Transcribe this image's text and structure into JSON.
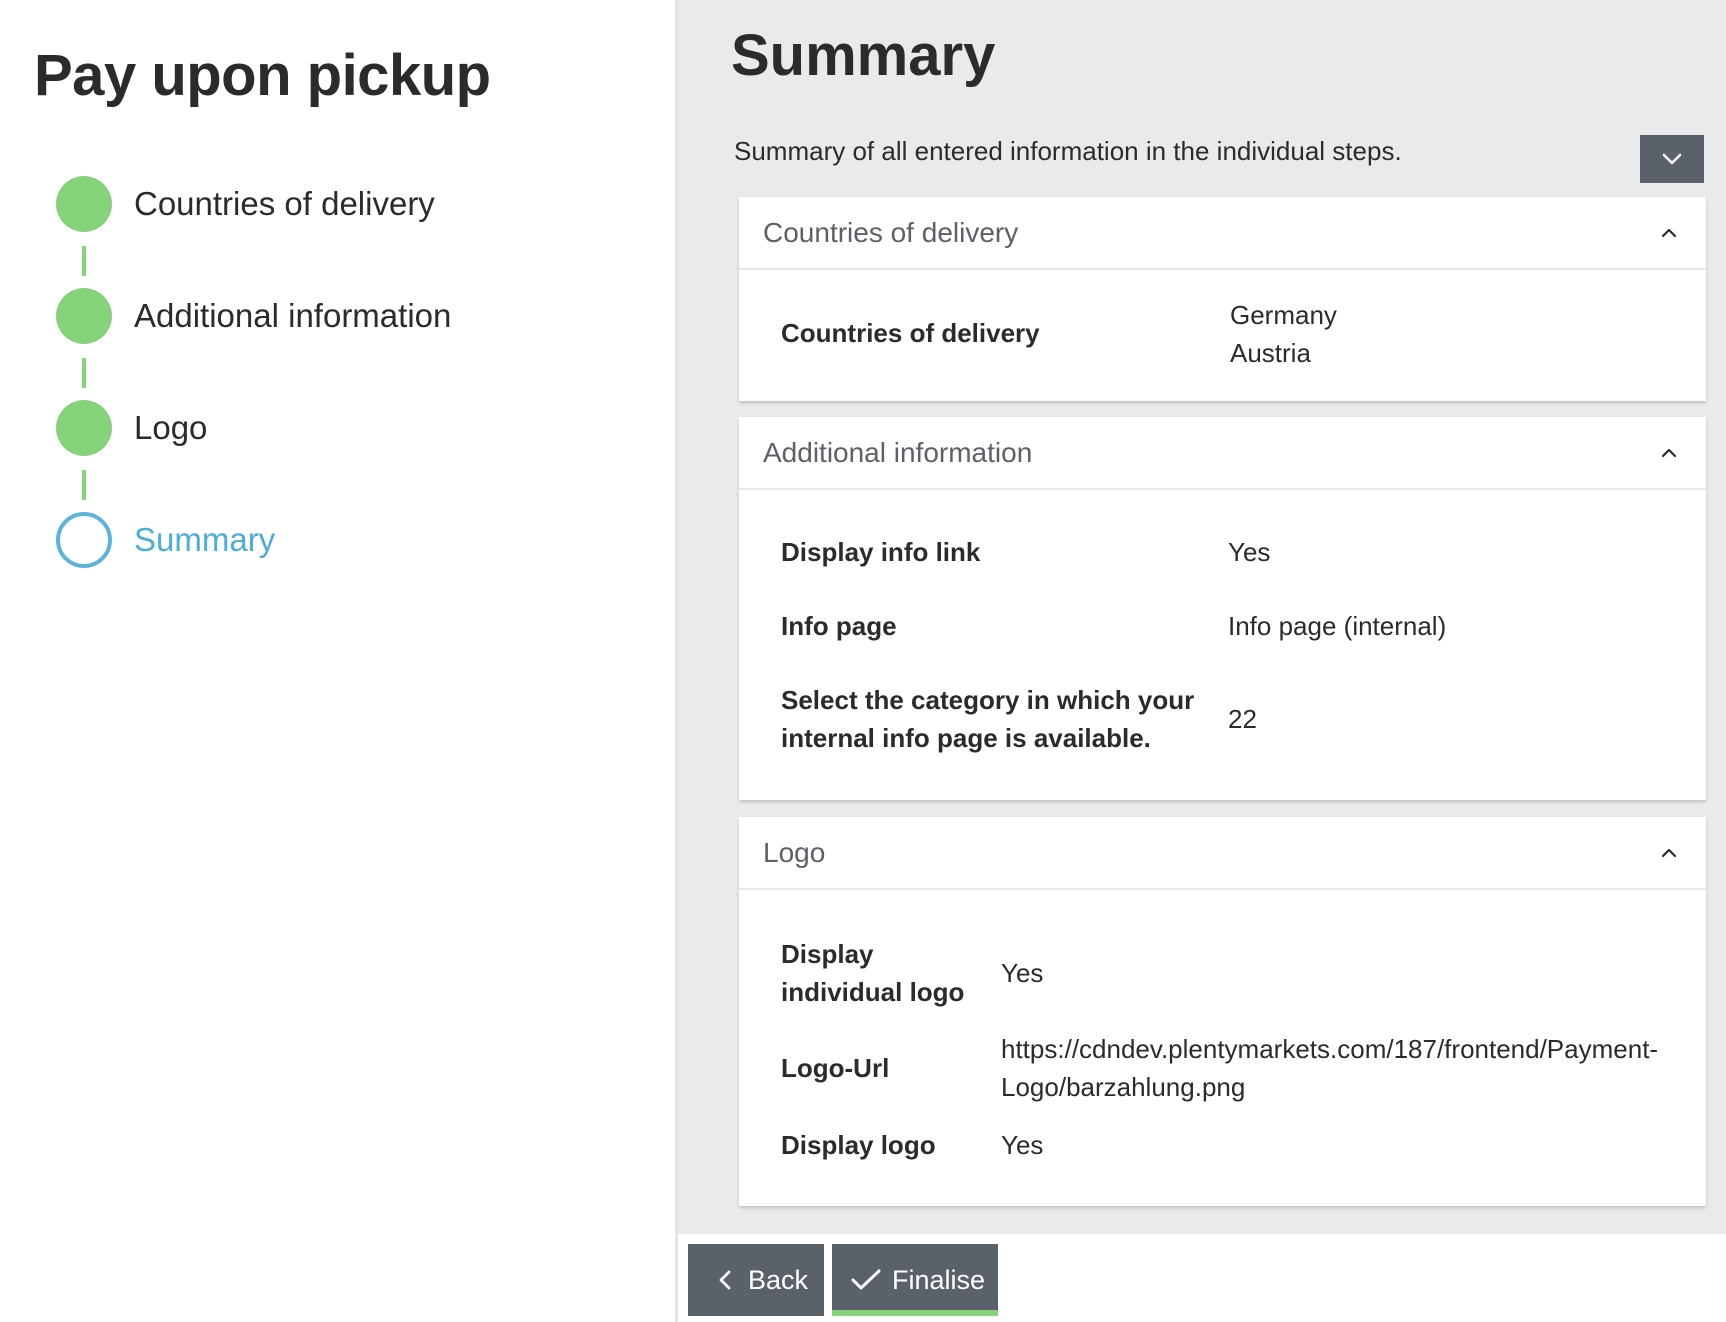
{
  "wizard": {
    "title": "Pay upon pickup",
    "steps": [
      {
        "label": "Countries of delivery",
        "state": "done"
      },
      {
        "label": "Additional information",
        "state": "done"
      },
      {
        "label": "Logo",
        "state": "done"
      },
      {
        "label": "Summary",
        "state": "current"
      }
    ]
  },
  "summary": {
    "title": "Summary",
    "description": "Summary of all entered information in the individual steps.",
    "sections": [
      {
        "title": "Countries of delivery",
        "rows": [
          {
            "label": "Countries of delivery",
            "value": "Germany",
            "value2": "Austria"
          }
        ]
      },
      {
        "title": "Additional information",
        "rows": [
          {
            "label": "Display info link",
            "value": "Yes"
          },
          {
            "label": "Info page",
            "value": "Info page (internal)"
          },
          {
            "label": "Select the category in which your",
            "label2": "internal info page is available.",
            "value": "22"
          }
        ]
      },
      {
        "title": "Logo",
        "rows": [
          {
            "label": "Display",
            "label2": "individual logo",
            "value": "Yes"
          },
          {
            "label": "Logo-Url",
            "value": "https://cdndev.plentymarkets.com/187/frontend/Payment-",
            "value2": "Logo/barzahlung.png"
          },
          {
            "label": "Display logo",
            "value": "Yes"
          }
        ]
      }
    ]
  },
  "footer": {
    "back_label": "Back",
    "finalise_label": "Finalise"
  },
  "colors": {
    "step_done": "#86d47a",
    "step_current": "#4aaed8",
    "button_bg": "#5b616b",
    "finalise_accent": "#86d47a"
  },
  "icons": {
    "toggle_all": "chevron-down-icon",
    "panel_collapse": "chevron-up-icon",
    "back": "chevron-left-icon",
    "finalise": "checkmark-icon"
  }
}
